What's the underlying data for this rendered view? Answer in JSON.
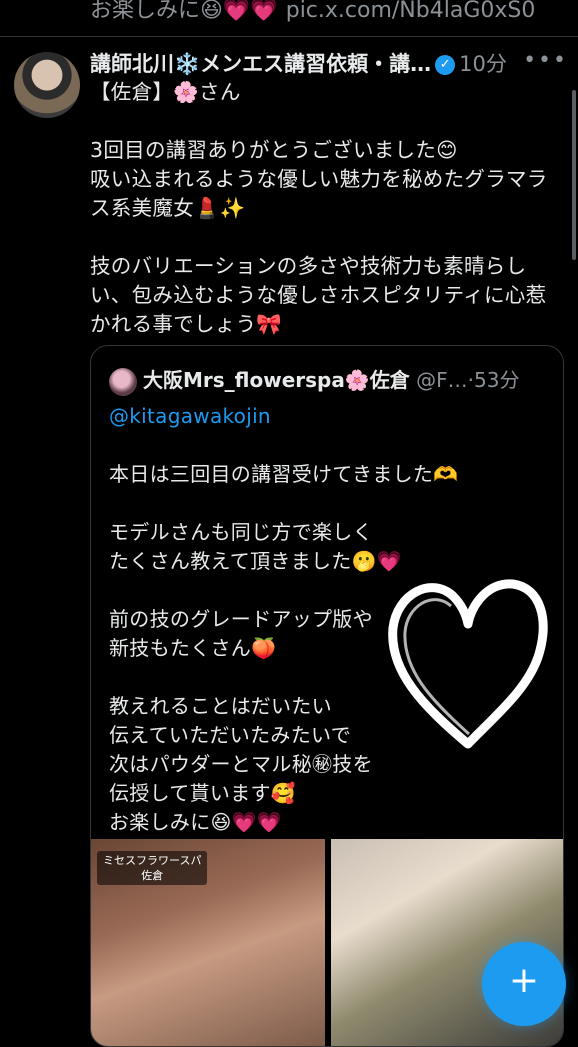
{
  "prev_tweet": {
    "text_tail": "お楽しみに😆💗💗",
    "link": "pic.x.com/Nb4laG0xS0"
  },
  "tweet": {
    "author_name": "講師北川❄️メンエス講習依頼・講…",
    "time": "10分",
    "more_icon": "more-icon",
    "paragraphs": [
      "【佐倉】🌸さん",
      "",
      "3回目の講習ありがとうございました😊",
      "吸い込まれるような優しい魅力を秘めたグラマラス系美魔女💄✨",
      "",
      "技のバリエーションの多さや技術力も素晴らしい、包み込むような優しさホスピタリティに心惹かれる事でしょう🎀"
    ]
  },
  "quote": {
    "author_name": "大阪Mrs_flowerspa🌸佐倉",
    "handle": "@F…",
    "time": "53分",
    "mention": "@kitagawakojin",
    "lines": [
      "本日は三回目の講習受けてきました🫶",
      "",
      "モデルさんも同じ方で楽しく",
      "たくさん教えて頂きました🫢💗",
      "",
      "前の技のグレードアップ版や",
      "新技もたくさん🍑",
      "",
      "教えれることはだいたい",
      "伝えていただいたみたいで",
      "次はパウダーとマル秘㊙技を",
      "伝授して貰います🥰",
      "お楽しみに😆💗💗"
    ],
    "media_watermark_1": "ミセスフラワースパ",
    "media_watermark_2": "佐倉"
  },
  "fab": {
    "icon": "plus-icon",
    "label": "+"
  },
  "colors": {
    "accent": "#1d9bf0",
    "muted": "#8b9196",
    "text": "#e7e9ea",
    "bg": "#000000"
  }
}
